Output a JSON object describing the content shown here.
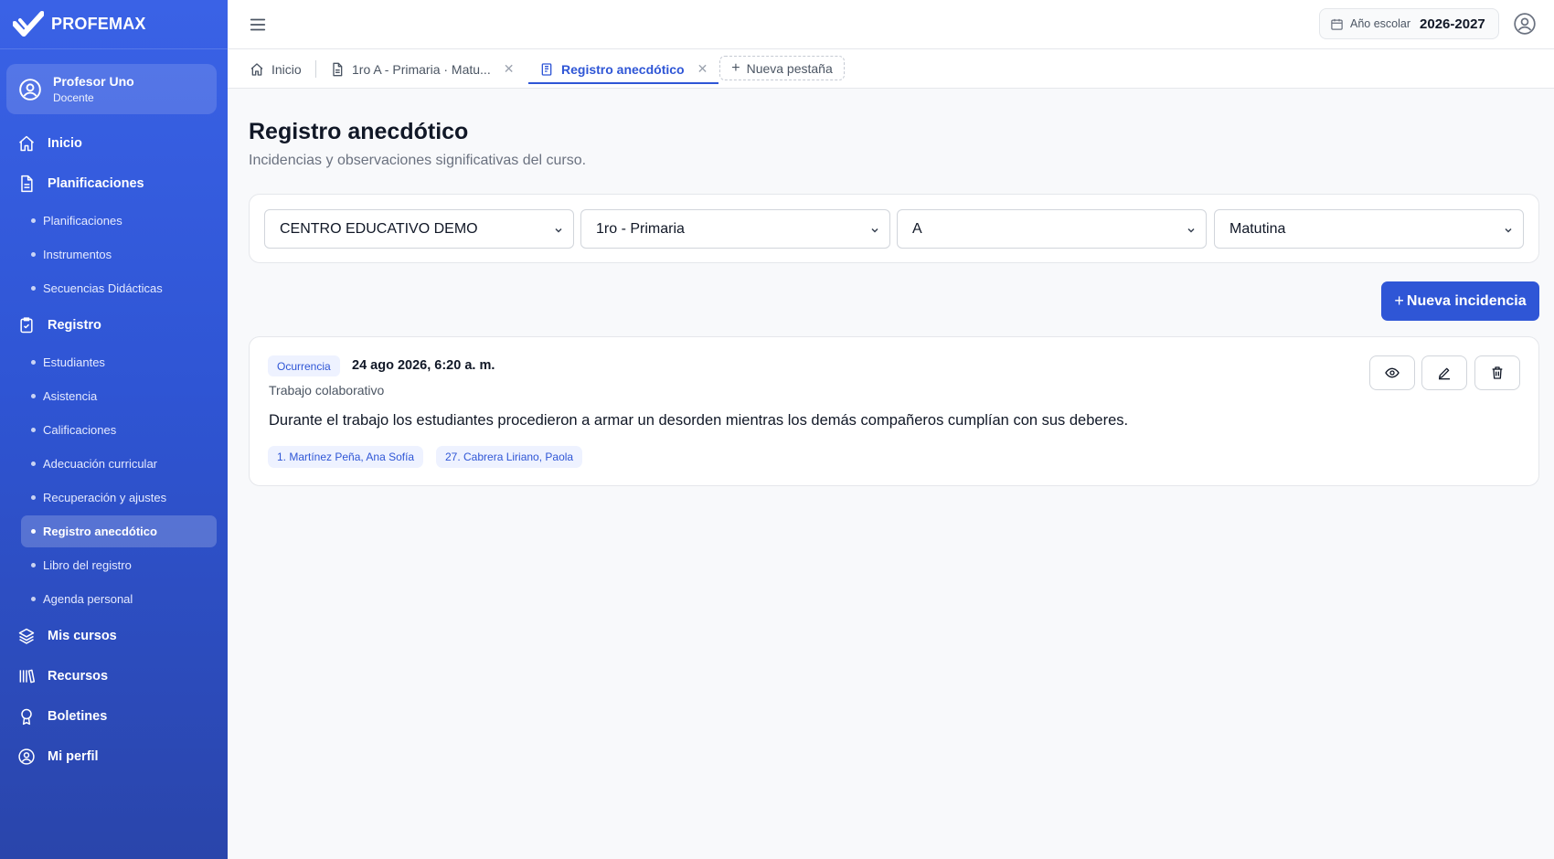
{
  "app": {
    "brand": "PROFEMAX"
  },
  "user": {
    "name": "Profesor Uno",
    "role": "Docente"
  },
  "sidebar": {
    "items": [
      {
        "label": "Inicio",
        "icon": "home-icon"
      },
      {
        "label": "Planificaciones",
        "icon": "document-icon",
        "children": [
          "Planificaciones",
          "Instrumentos",
          "Secuencias Didácticas"
        ]
      },
      {
        "label": "Registro",
        "icon": "clipboard-check-icon",
        "children": [
          "Estudiantes",
          "Asistencia",
          "Calificaciones",
          "Adecuación curricular",
          "Recuperación y ajustes",
          "Registro anecdótico",
          "Libro del registro",
          "Agenda personal"
        ]
      },
      {
        "label": "Mis cursos",
        "icon": "layers-icon"
      },
      {
        "label": "Recursos",
        "icon": "library-icon"
      },
      {
        "label": "Boletines",
        "icon": "award-icon"
      },
      {
        "label": "Mi perfil",
        "icon": "user-circle-icon"
      }
    ],
    "active_child": "Registro anecdótico"
  },
  "topbar": {
    "year_label": "Año escolar",
    "year_value": "2026-2027"
  },
  "tabs": [
    {
      "label": "Inicio",
      "icon": "home-icon"
    },
    {
      "label": "1ro A - Primaria · Matu...",
      "icon": "document-icon",
      "closable": true
    },
    {
      "label": "Registro anecdótico",
      "icon": "book-icon",
      "closable": true,
      "active": true
    }
  ],
  "new_tab_label": "Nueva pestaña",
  "page": {
    "title": "Registro anecdótico",
    "subtitle": "Incidencias y observaciones significativas del curso."
  },
  "filters": {
    "center": "CENTRO EDUCATIVO DEMO",
    "grade": "1ro - Primaria",
    "section": "A",
    "shift": "Matutina"
  },
  "new_incident_label": "Nueva incidencia",
  "incident": {
    "type": "Ocurrencia",
    "date": "24 ago 2026, 6:20 a. m.",
    "category": "Trabajo colaborativo",
    "description": "Durante el trabajo los estudiantes procedieron a armar un desorden mientras los demás compañeros cumplían con sus deberes.",
    "students": [
      "1. Martínez Peña, Ana Sofía",
      "27. Cabrera Liriano, Paola"
    ]
  },
  "colors": {
    "accent": "#2f56d6",
    "sidebar_top": "#3a62e6",
    "sidebar_bottom": "#2a45ab"
  }
}
